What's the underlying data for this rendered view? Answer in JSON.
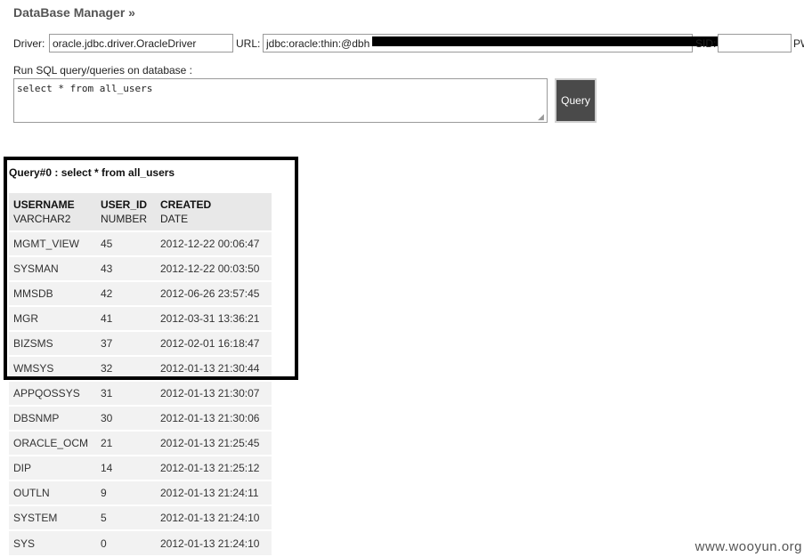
{
  "header": {
    "title": "DataBase Manager »"
  },
  "connection": {
    "driver_label": "Driver:",
    "driver_value": "oracle.jdbc.driver.OracleDriver",
    "url_label": "URL:",
    "url_value": "jdbc:oracle:thin:@dbh",
    "sid_label": "SID:",
    "pw_label": "PW"
  },
  "sql": {
    "label": "Run SQL query/queries on database :",
    "query_text": "select * from all_users",
    "button_label": "Query"
  },
  "result": {
    "title": "Query#0 : select * from all_users",
    "columns": [
      {
        "name": "USERNAME",
        "type": "VARCHAR2"
      },
      {
        "name": "USER_ID",
        "type": "NUMBER"
      },
      {
        "name": "CREATED",
        "type": "DATE"
      }
    ],
    "rows": [
      [
        "MGMT_VIEW",
        "45",
        "2012-12-22 00:06:47"
      ],
      [
        "SYSMAN",
        "43",
        "2012-12-22 00:03:50"
      ],
      [
        "MMSDB",
        "42",
        "2012-06-26 23:57:45"
      ],
      [
        "MGR",
        "41",
        "2012-03-31 13:36:21"
      ],
      [
        "BIZSMS",
        "37",
        "2012-02-01 16:18:47"
      ],
      [
        "WMSYS",
        "32",
        "2012-01-13 21:30:44"
      ],
      [
        "APPQOSSYS",
        "31",
        "2012-01-13 21:30:07"
      ],
      [
        "DBSNMP",
        "30",
        "2012-01-13 21:30:06"
      ],
      [
        "ORACLE_OCM",
        "21",
        "2012-01-13 21:25:45"
      ],
      [
        "DIP",
        "14",
        "2012-01-13 21:25:12"
      ],
      [
        "OUTLN",
        "9",
        "2012-01-13 21:24:11"
      ],
      [
        "SYSTEM",
        "5",
        "2012-01-13 21:24:10"
      ],
      [
        "SYS",
        "0",
        "2012-01-13 21:24:10"
      ]
    ]
  },
  "watermark": "www.wooyun.org"
}
